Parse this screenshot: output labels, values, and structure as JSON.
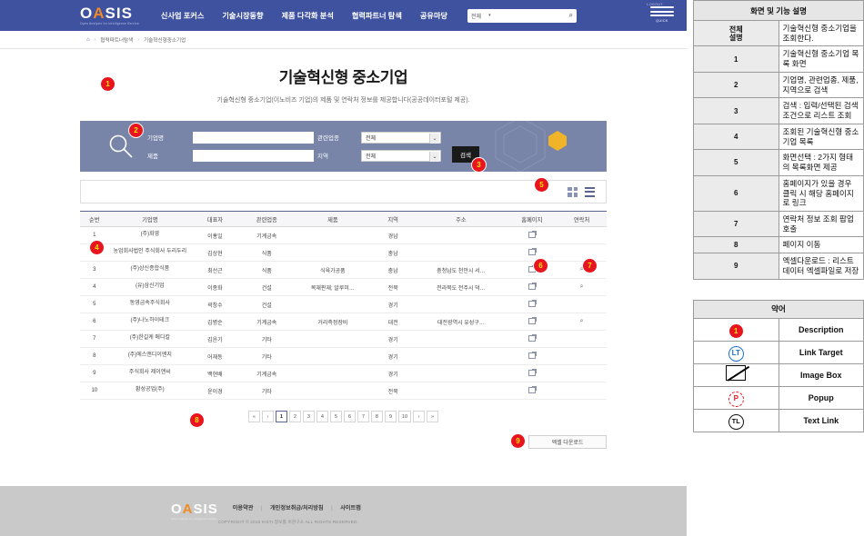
{
  "header": {
    "logo_main": "OASIS",
    "logo_accent": "A",
    "logo_sub": "Open Analysis for Intelligence Service",
    "logout": "LOGOUT",
    "quick_label": "QUICK",
    "nav": [
      {
        "label": "신사업 포커스"
      },
      {
        "label": "기술시장동향"
      },
      {
        "label": "제품 다각화 분석"
      },
      {
        "label": "협력파트너 탐색"
      },
      {
        "label": "공유마당"
      }
    ],
    "search": {
      "selected": "전체",
      "caret": "▾",
      "icon": "search-icon"
    }
  },
  "breadcrumb": {
    "home_icon": "home-icon",
    "sep": "›",
    "items": [
      "협력파트너탐색",
      "기술혁신형중소기업"
    ]
  },
  "page": {
    "title": "기술혁신형 중소기업",
    "subtitle": "기술혁신형 중소기업(이노비즈 기업)의 제품 및 연락처 정보를 제공합니다(공공데이터포털 제공)."
  },
  "search_panel": {
    "company_label": "기업명",
    "company_value": "",
    "product_label": "제품",
    "product_value": "",
    "industry_label": "관련업종",
    "industry_value": "전체",
    "region_label": "지역",
    "region_value": "전체",
    "search_button": "검색",
    "select_arrow": "⌄"
  },
  "view_toggle": {
    "grid_icon": "grid-view-icon",
    "list_icon": "list-view-icon"
  },
  "table": {
    "columns": [
      "순번",
      "기업명",
      "대표자",
      "관련업종",
      "제품",
      "지역",
      "주소",
      "홈페이지",
      "연락처"
    ],
    "rows": [
      {
        "no": "1",
        "name": "(주)화영",
        "ceo": "이홍일",
        "industry": "기계금속",
        "product": "",
        "region": "경남",
        "address": "",
        "home": true,
        "tel": false
      },
      {
        "no": "2",
        "name": "농업회사법인 주식회사 두리두리",
        "ceo": "김상현",
        "industry": "식품",
        "product": "",
        "region": "충남",
        "address": "",
        "home": true,
        "tel": false
      },
      {
        "no": "3",
        "name": "(주)상신종합식품",
        "ceo": "최선근",
        "industry": "식품",
        "product": "식육가공품",
        "region": "충남",
        "address": "충청남도 천안시 서…",
        "home": true,
        "tel": true
      },
      {
        "no": "4",
        "name": "(유)삼신기업",
        "ceo": "이종화",
        "industry": "건설",
        "product": "목재판재; 알루미…",
        "region": "전북",
        "address": "전라북도 전주시 덕…",
        "home": true,
        "tel": true
      },
      {
        "no": "5",
        "name": "동영금속주식회사",
        "ceo": "곽창수",
        "industry": "건설",
        "product": "",
        "region": "경기",
        "address": "",
        "home": true,
        "tel": false
      },
      {
        "no": "6",
        "name": "(주)나노하이테크",
        "ceo": "김병순",
        "industry": "기계금속",
        "product": "거리측정장비",
        "region": "대전",
        "address": "대전광역시 유성구…",
        "home": true,
        "tel": true
      },
      {
        "no": "7",
        "name": "(주)한길케 메디칼",
        "ceo": "김윤기",
        "industry": "기타",
        "product": "",
        "region": "경기",
        "address": "",
        "home": true,
        "tel": false
      },
      {
        "no": "8",
        "name": "(주)에스앤디이엔지",
        "ceo": "어재동",
        "industry": "기타",
        "product": "",
        "region": "경기",
        "address": "",
        "home": true,
        "tel": false
      },
      {
        "no": "9",
        "name": "주식회사 제이앤씨",
        "ceo": "백현배",
        "industry": "기계금속",
        "product": "",
        "region": "경기",
        "address": "",
        "home": true,
        "tel": false
      },
      {
        "no": "10",
        "name": "황성공업(주)",
        "ceo": "윤이경",
        "industry": "기타",
        "product": "",
        "region": "전북",
        "address": "",
        "home": true,
        "tel": false
      }
    ],
    "home_icon": "homepage-link-icon",
    "tel_icon": "contact-search-icon"
  },
  "pagination": {
    "first": "«",
    "prev": "‹",
    "next": "›",
    "last": "»",
    "pages": [
      "1",
      "2",
      "3",
      "4",
      "5",
      "6",
      "7",
      "8",
      "9",
      "10"
    ],
    "active": "1"
  },
  "excel": {
    "label": "엑셀 다운로드"
  },
  "footer": {
    "logo_main": "OASIS",
    "logo_sub": "Open Analysis for Intelligence Service",
    "links": [
      "이용약관",
      "개인정보취급/처리방침",
      "사이트맵"
    ],
    "divider": "|",
    "copyright": "COPYRIGHT © 2015 KISTI 정보를 비관구소 ALL RIGHTS RESERVED."
  },
  "callouts": [
    {
      "n": "1"
    },
    {
      "n": "2"
    },
    {
      "n": "3"
    },
    {
      "n": "4"
    },
    {
      "n": "5"
    },
    {
      "n": "6"
    },
    {
      "n": "7"
    },
    {
      "n": "8"
    },
    {
      "n": "9"
    }
  ],
  "spec": {
    "title": "화면 및 기능 설명",
    "rows": [
      {
        "num": "전체\n설명",
        "num_line1": "전체",
        "num_line2": "설명",
        "desc": "기술혁신형 중소기업을 조회한다."
      },
      {
        "num": "1",
        "desc": "기술혁신형 중소기업 목록 화면"
      },
      {
        "num": "2",
        "desc": "기업명, 관련업종, 제품, 지역으로 검색"
      },
      {
        "num": "3",
        "desc": "검색 : 입력/선택된 검색조건으로 리스트 조회"
      },
      {
        "num": "4",
        "desc": "조회된 기술혁신형 중소기업 목록"
      },
      {
        "num": "5",
        "desc": "화면선택 : 2가지 형태의 목록화면 제공"
      },
      {
        "num": "6",
        "desc": "홈페이지가 있을 경우 클릭 시 해당 홈페이지로 링크"
      },
      {
        "num": "7",
        "desc": "연락처 정보 조회 팝업 호출"
      },
      {
        "num": "8",
        "desc": "페이지 이동"
      },
      {
        "num": "9",
        "desc": "엑셀다운로드 : 리스트 데이터 엑셀파일로 저장"
      }
    ]
  },
  "legend": {
    "title": "약어",
    "rows": [
      {
        "symbol": "description-badge-icon",
        "symbol_text": "1",
        "label": "Description"
      },
      {
        "symbol": "link-target-icon",
        "symbol_text": "LT",
        "label": "Link Target"
      },
      {
        "symbol": "image-box-icon",
        "symbol_text": "",
        "label": "Image Box"
      },
      {
        "symbol": "popup-icon",
        "symbol_text": "P",
        "label": "Popup"
      },
      {
        "symbol": "text-link-icon",
        "symbol_text": "TL",
        "label": "Text Link"
      }
    ]
  },
  "colors": {
    "nav_blue": "#3f52a0",
    "panel_blue": "#7885a8",
    "accent_orange": "#f08a24",
    "callout_red": "#e8141e",
    "callout_yellow": "#ffe400"
  }
}
